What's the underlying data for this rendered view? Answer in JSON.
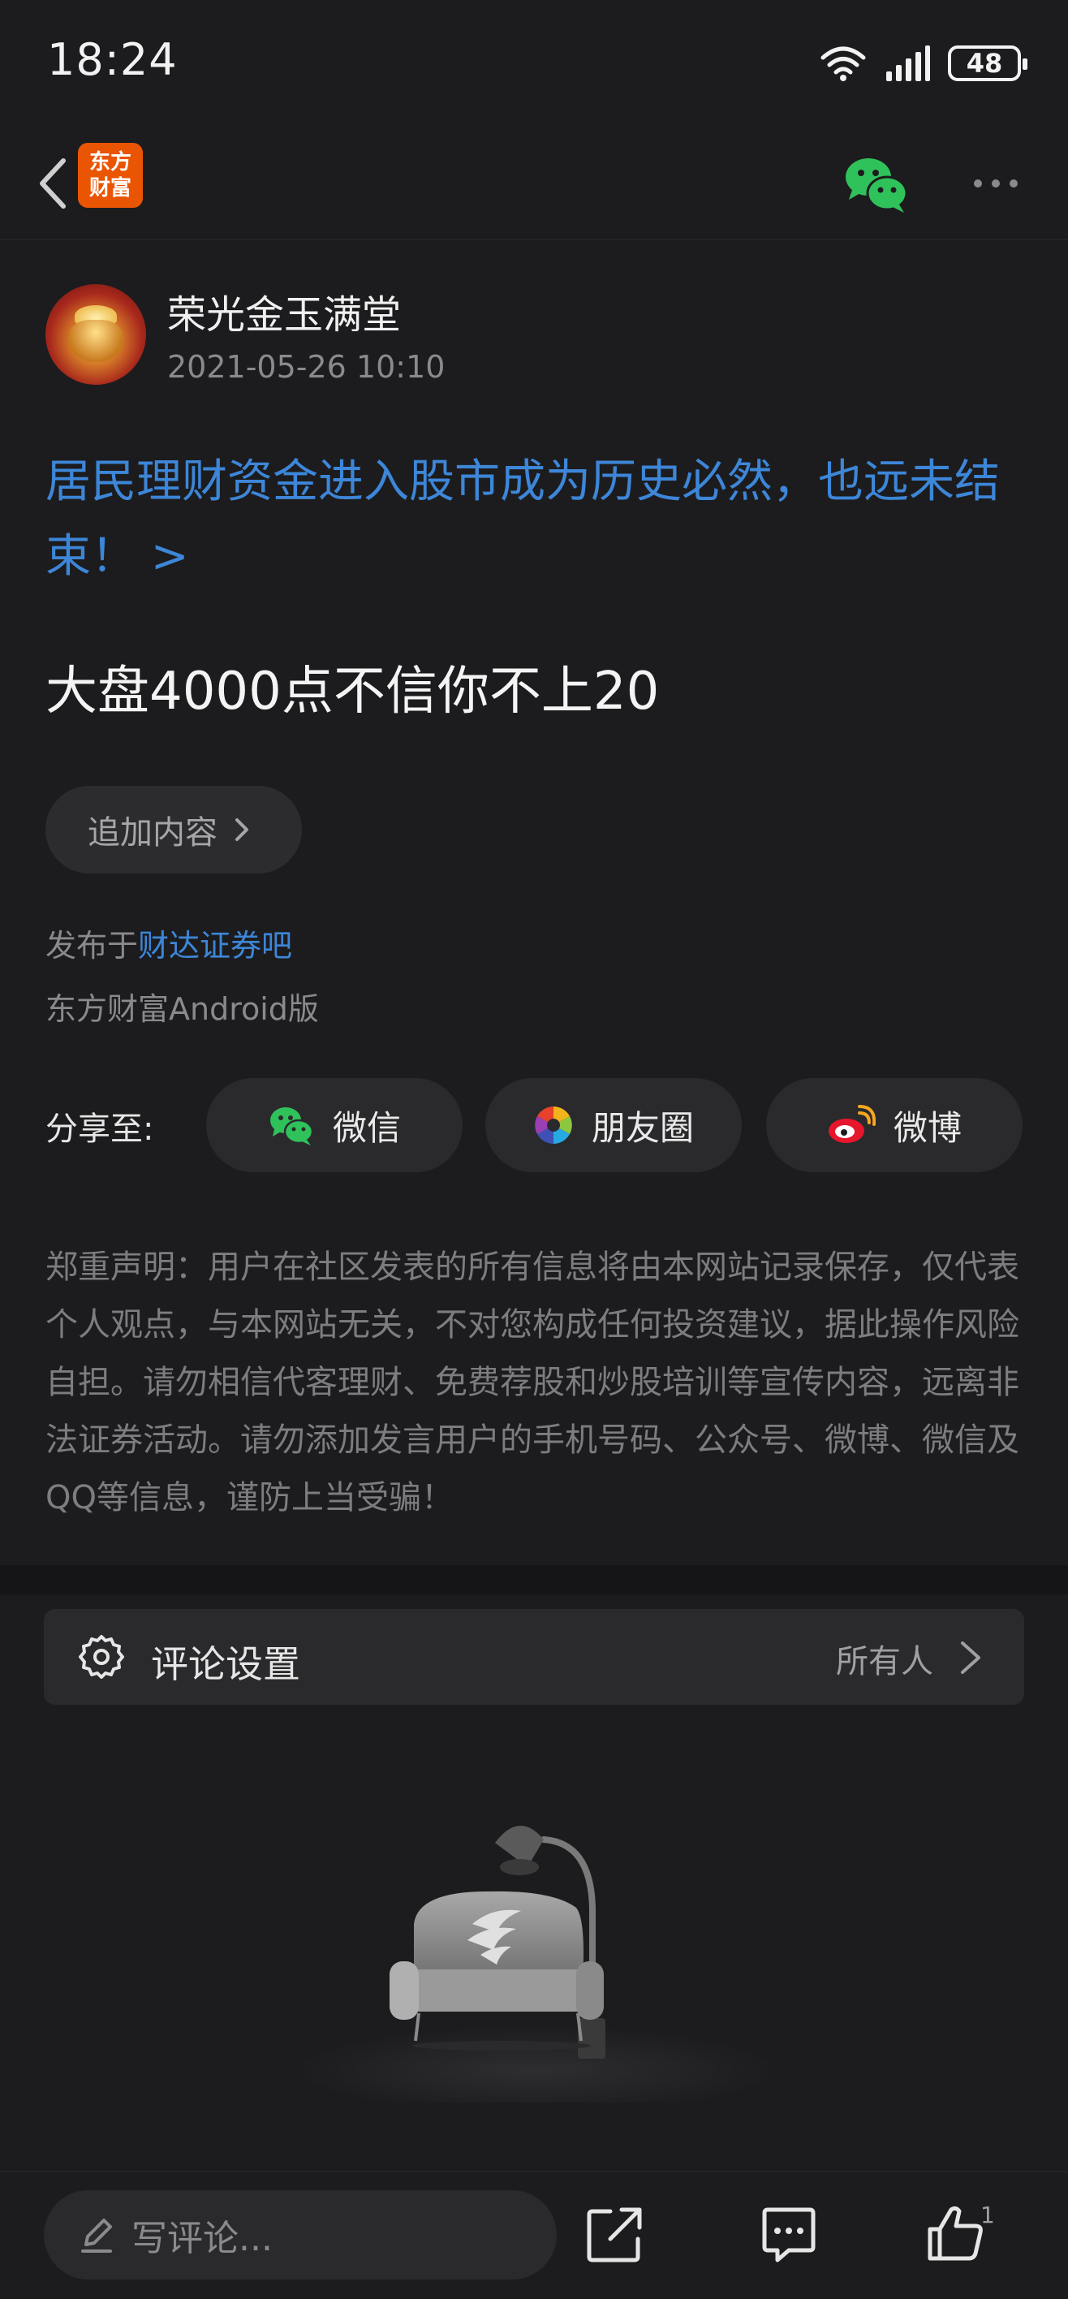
{
  "status_bar": {
    "time": "18:24",
    "battery": "48"
  },
  "nav": {
    "logo_line1": "东方",
    "logo_line2": "财富"
  },
  "author": {
    "name": "荣光金玉满堂",
    "time": "2021-05-26 10:10"
  },
  "headline_link": "居民理财资金进入股市成为历史必然，也远未结束！ >",
  "post_body": "大盘4000点不信你不上20",
  "add_content": {
    "label": "追加内容"
  },
  "posted_in": {
    "prefix": "发布于",
    "forum": "财达证券吧"
  },
  "client_info": "东方财富Android版",
  "share": {
    "label": "分享至:",
    "wechat": "微信",
    "moments": "朋友圈",
    "weibo": "微博"
  },
  "disclaimer": "郑重声明：用户在社区发表的所有信息将由本网站记录保存，仅代表个人观点，与本网站无关，不对您构成任何投资建议，据此操作风险自担。请勿相信代客理财、免费荐股和炒股培训等宣传内容，远离非法证券活动。请勿添加发言用户的手机号码、公众号、微博、微信及QQ等信息，谨防上当受骗！",
  "comment_settings": {
    "label": "评论设置",
    "value": "所有人"
  },
  "bottom_bar": {
    "comment_placeholder": "写评论...",
    "like_count": "1"
  }
}
